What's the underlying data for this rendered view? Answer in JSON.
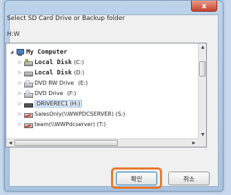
{
  "window": {
    "close_glyph": "x"
  },
  "dialog": {
    "prompt": "Select SD Card Drive or Backup folder",
    "path": "H:W"
  },
  "tree": {
    "nodes": [
      {
        "expander": "◢",
        "icon": "computer-icon",
        "label": "My Computer",
        "bold": true
      },
      {
        "expander": "▷",
        "icon": "local-disk-icon",
        "label": "Local Disk",
        "suffix": "(C:)"
      },
      {
        "expander": "▷",
        "icon": "local-disk-icon",
        "label": "Local Disk",
        "suffix": "(D:)"
      },
      {
        "expander": "▷",
        "icon": "dvd-drive-icon",
        "label": "DVD RW Drive",
        "suffix": "(E:)"
      },
      {
        "expander": "▷",
        "icon": "dvd-drive-icon",
        "label": "DVD Drive",
        "suffix": "(F:)"
      },
      {
        "expander": "▷",
        "icon": "usb-drive-icon",
        "label": "DRIVEREC1 (H:)",
        "selected": true
      },
      {
        "expander": "▷",
        "icon": "network-drive-icon",
        "label": "SalesOnly(\\\\WWPDCSERVER) (S:)"
      },
      {
        "expander": "▷",
        "icon": "network-drive-icon",
        "label": "team(\\\\WWPdcserver) (T:)"
      }
    ]
  },
  "buttons": {
    "ok_label": "확인",
    "cancel_label": "취소"
  },
  "colors": {
    "highlight": "#e8782a",
    "selection": "#dbe8f7"
  }
}
